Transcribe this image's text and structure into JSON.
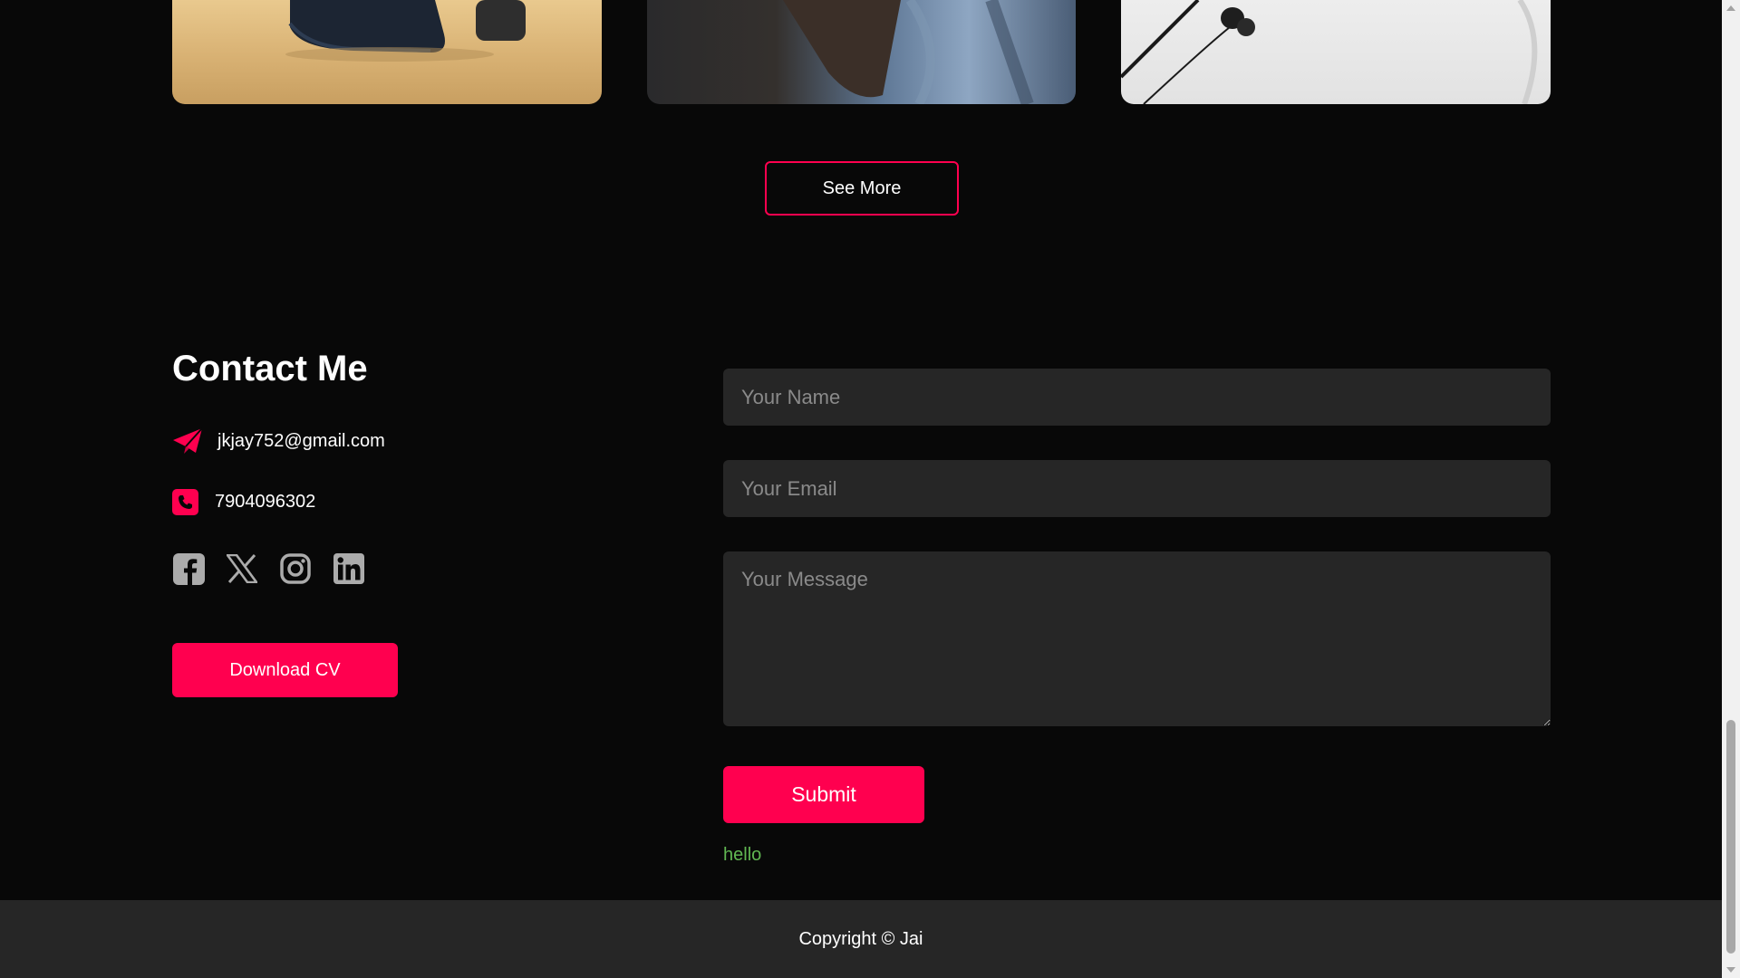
{
  "work": {
    "cards": [
      {
        "name": "work-card-1"
      },
      {
        "name": "work-card-2"
      },
      {
        "name": "work-card-3"
      }
    ],
    "see_more_label": "See More"
  },
  "contact": {
    "title": "Contact Me",
    "email": "jkjay752@gmail.com",
    "phone": "7904096302",
    "socials": [
      "facebook-icon",
      "x-twitter-icon",
      "instagram-icon",
      "linkedin-icon"
    ],
    "download_label": "Download CV"
  },
  "form": {
    "name_placeholder": "Your Name",
    "email_placeholder": "Your Email",
    "message_placeholder": "Your Message",
    "submit_label": "Submit",
    "status_message": "hello"
  },
  "footer": {
    "copyright": "Copyright © Jai"
  },
  "colors": {
    "accent": "#ff004f",
    "background": "#080808",
    "field_bg": "#262626",
    "footer_bg": "#262626",
    "success_text": "#61b752"
  }
}
